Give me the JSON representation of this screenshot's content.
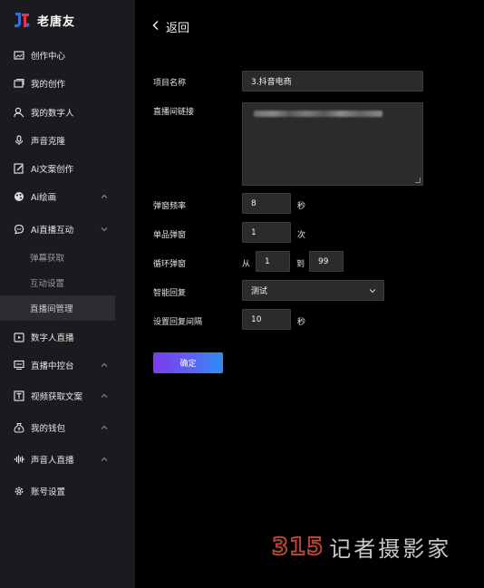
{
  "app": {
    "name": "老唐友"
  },
  "sidebar": {
    "items": [
      {
        "label": "创作中心",
        "icon": "image-icon"
      },
      {
        "label": "我的创作",
        "icon": "gallery-icon"
      },
      {
        "label": "我的数字人",
        "icon": "person-icon"
      },
      {
        "label": "声音克隆",
        "icon": "microphone-icon"
      },
      {
        "label": "Ai文案创作",
        "icon": "edit-icon"
      },
      {
        "label": "Ai绘画",
        "icon": "palette-icon",
        "expand": "collapsed"
      },
      {
        "label": "Ai直播互动",
        "icon": "chat-icon",
        "expand": "expanded"
      },
      {
        "label": "数字人直播",
        "icon": "live-icon"
      },
      {
        "label": "直播中控台",
        "icon": "monitor-icon",
        "expand": "collapsed"
      },
      {
        "label": "视频获取文案",
        "icon": "text-icon",
        "expand": "collapsed"
      },
      {
        "label": "我的钱包",
        "icon": "wallet-icon",
        "expand": "collapsed"
      },
      {
        "label": "声音人直播",
        "icon": "waveform-icon",
        "expand": "collapsed"
      },
      {
        "label": "账号设置",
        "icon": "gear-icon"
      }
    ],
    "sub_items": [
      {
        "label": "弹幕获取",
        "active": false
      },
      {
        "label": "互动设置",
        "active": false
      },
      {
        "label": "直播间管理",
        "active": true
      }
    ]
  },
  "main": {
    "back_label": "返回",
    "form": {
      "project_name": {
        "label": "项目名称",
        "value": "3.抖音电商"
      },
      "live_link": {
        "label": "直播间链接"
      },
      "barrage_freq": {
        "label": "弹窗频率",
        "value": "8",
        "unit": "秒"
      },
      "single_popup": {
        "label": "单品弹窗",
        "value": "1",
        "unit": "次"
      },
      "loop_popup": {
        "label": "循环弹窗",
        "from_label": "从",
        "from_value": "1",
        "to_label": "到",
        "to_value": "99"
      },
      "smart_reply": {
        "label": "智能回复",
        "value": "测试"
      },
      "reply_interval": {
        "label": "设置回复间隔",
        "value": "10",
        "unit": "秒"
      }
    },
    "confirm_label": "确定"
  },
  "watermark": {
    "number": "315",
    "text": "记者摄影家"
  },
  "colors": {
    "accent_start": "#7b3cf0",
    "accent_end": "#2d8ff5",
    "logo_red": "#e8343c",
    "logo_blue": "#2f6fe0",
    "watermark_red": "#c74a3a"
  }
}
